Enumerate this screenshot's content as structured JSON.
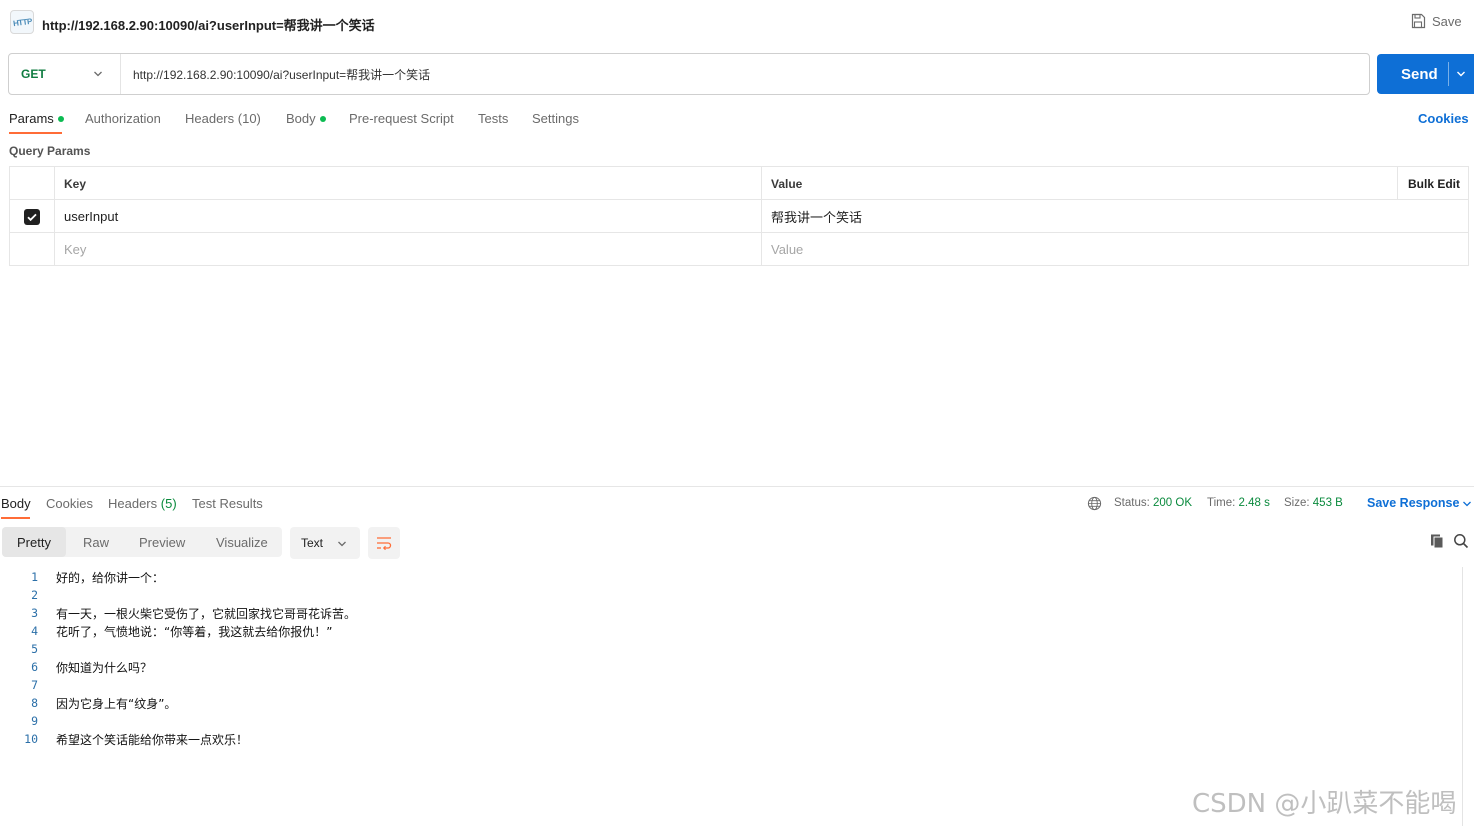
{
  "header": {
    "icon": "http-request-icon",
    "icon_label": "HTTP",
    "title": "http://192.168.2.90:10090/ai?userInput=帮我讲一个笑话",
    "save_label": "Save"
  },
  "request": {
    "method": "GET",
    "url": "http://192.168.2.90:10090/ai?userInput=帮我讲一个笑话",
    "send_label": "Send"
  },
  "request_tabs": [
    {
      "label": "Params",
      "active": true,
      "dot": true
    },
    {
      "label": "Authorization"
    },
    {
      "label": "Headers",
      "count": "(10)"
    },
    {
      "label": "Body",
      "dot": true
    },
    {
      "label": "Pre-request Script"
    },
    {
      "label": "Tests"
    },
    {
      "label": "Settings"
    }
  ],
  "cookies_label": "Cookies",
  "query_params": {
    "title": "Query Params",
    "columns": {
      "key": "Key",
      "value": "Value",
      "bulk_edit": "Bulk Edit"
    },
    "rows": [
      {
        "checked": true,
        "key": "userInput",
        "value": "帮我讲一个笑话"
      }
    ],
    "new_row": {
      "key_placeholder": "Key",
      "value_placeholder": "Value"
    }
  },
  "response": {
    "tabs": [
      {
        "label": "Body",
        "active": true
      },
      {
        "label": "Cookies"
      },
      {
        "label": "Headers",
        "count": "(5)"
      },
      {
        "label": "Test Results"
      }
    ],
    "status_label": "Status:",
    "status_value": "200 OK",
    "time_label": "Time:",
    "time_value": "2.48 s",
    "size_label": "Size:",
    "size_value": "453 B",
    "save_response_label": "Save Response",
    "view_modes": [
      "Pretty",
      "Raw",
      "Preview",
      "Visualize"
    ],
    "active_view": "Pretty",
    "format": "Text",
    "lines": [
      {
        "n": "1",
        "text": "好的，给你讲一个："
      },
      {
        "n": "2",
        "text": ""
      },
      {
        "n": "3",
        "text": "有一天，一根火柴它受伤了，它就回家找它哥哥花诉苦。"
      },
      {
        "n": "4",
        "text": "花听了，气愤地说：“你等着，我这就去给你报仇！”"
      },
      {
        "n": "5",
        "text": ""
      },
      {
        "n": "6",
        "text": "你知道为什么吗？"
      },
      {
        "n": "7",
        "text": ""
      },
      {
        "n": "8",
        "text": "因为它身上有“纹身”。"
      },
      {
        "n": "9",
        "text": ""
      },
      {
        "n": "10",
        "text": "希望这个笑话能给你带来一点欢乐！"
      }
    ]
  },
  "watermark": "CSDN @小趴菜不能喝",
  "colors": {
    "accent_blue": "#0e6fd6",
    "method_green": "#107c41",
    "status_green": "#0a8a3d",
    "tab_underline": "#ff6c37",
    "dot_green": "#0cbb52"
  }
}
